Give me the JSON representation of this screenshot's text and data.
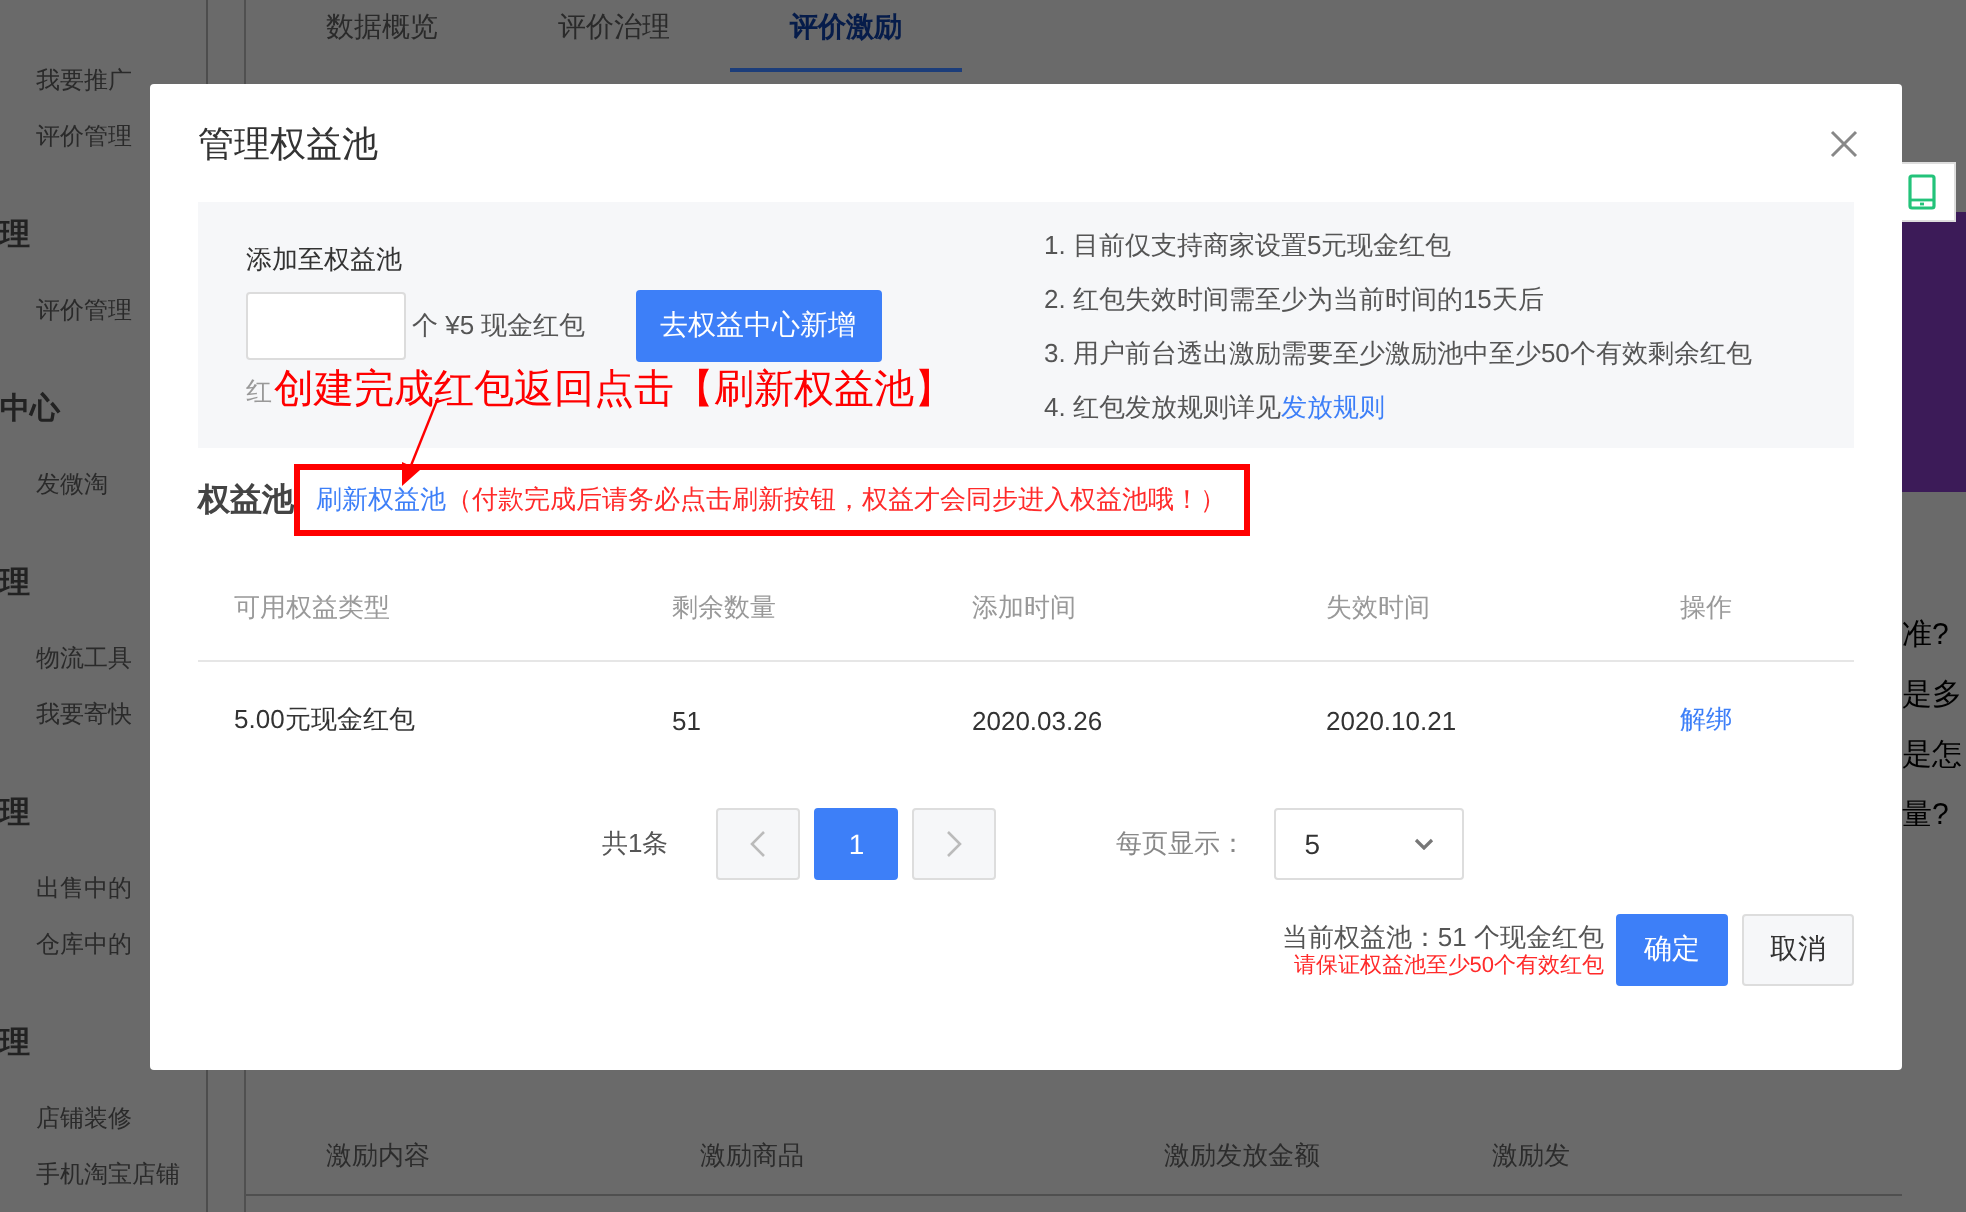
{
  "background": {
    "sidebar": [
      {
        "kind": "item",
        "label": "我要推广"
      },
      {
        "kind": "item",
        "label": "评价管理"
      },
      {
        "kind": "heading",
        "label": "理"
      },
      {
        "kind": "item",
        "label": "评价管理"
      },
      {
        "kind": "heading",
        "label": "中心"
      },
      {
        "kind": "item",
        "label": "发微淘"
      },
      {
        "kind": "heading",
        "label": "理"
      },
      {
        "kind": "item",
        "label": "物流工具"
      },
      {
        "kind": "item",
        "label": "我要寄快"
      },
      {
        "kind": "heading",
        "label": "理"
      },
      {
        "kind": "item",
        "label": "出售中的"
      },
      {
        "kind": "item",
        "label": "仓库中的"
      },
      {
        "kind": "heading",
        "label": "理"
      },
      {
        "kind": "item",
        "label": "店铺装修"
      },
      {
        "kind": "item",
        "label": "手机淘宝店铺"
      }
    ],
    "tabs": [
      {
        "label": "数据概览",
        "selected": false
      },
      {
        "label": "评价治理",
        "selected": false
      },
      {
        "label": "评价激励",
        "selected": true
      }
    ],
    "faq_fragments": [
      "准?",
      "是多",
      "是怎",
      "量?"
    ],
    "bottom_table": {
      "columns": [
        "激励内容",
        "激励商品",
        "激励发放金额",
        "激励发"
      ]
    }
  },
  "dialog": {
    "title": "管理权益池",
    "add": {
      "label": "添加至权益池",
      "unit": "个 ¥5 现金红包",
      "button": "去权益中心新增",
      "hint": "红"
    },
    "notes": [
      {
        "text": "1. 目前仅支持商家设置5元现金红包"
      },
      {
        "text": "2. 红包失效时间需至少为当前时间的15天后"
      },
      {
        "text": "3. 用户前台透出激励需要至少激励池中至少50个有效剩余红包"
      },
      {
        "text": "4. 红包发放规则详见",
        "link": "发放规则"
      }
    ],
    "pool": {
      "title": "权益池",
      "refresh_link": "刷新权益池",
      "notice": "（付款完成后请务必点击刷新按钮，权益才会同步进入权益池哦！）"
    },
    "table": {
      "columns": [
        "可用权益类型",
        "剩余数量",
        "添加时间",
        "失效时间",
        "操作"
      ],
      "rows": [
        {
          "cells": [
            "5.00元现金红包",
            "51",
            "2020.03.26",
            "2020.10.21"
          ],
          "action": "解绑"
        }
      ]
    },
    "pagination": {
      "total": "共1条",
      "pages": [
        {
          "label": "1",
          "selected": true
        }
      ],
      "page_size_label": "每页显示：",
      "page_size": "5"
    },
    "footer": {
      "summary": "当前权益池：51 个现金红包",
      "warning": "请保证权益池至少50个有效红包",
      "buttons": [
        {
          "label": "确定",
          "kind": "primary"
        },
        {
          "label": "取消",
          "kind": "default"
        }
      ]
    }
  },
  "annotation": {
    "text": "创建完成红包返回点击【刷新权益池】"
  }
}
